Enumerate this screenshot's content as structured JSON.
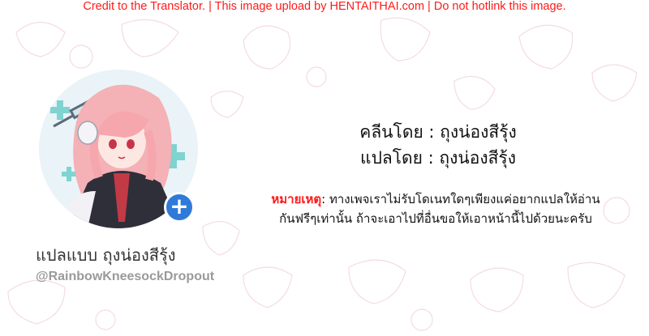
{
  "banner": {
    "text": "Credit to the Translator. | This image upload by HENTAITHAI.com | Do not hotlink this image.",
    "color": "#ff1a1a"
  },
  "profile": {
    "name": "แปลแบบ ถุงน่องสีรุ้ง",
    "handle": "@RainbowKneesockDropout",
    "badge_icon": "plus-icon",
    "badge_color": "#2f7ad8"
  },
  "credits": {
    "cleaned_by": "คลีนโดย : ถุงน่องสีรุ้ง",
    "translated_by": "แปลโดย : ถุงน่องสีรุ้ง"
  },
  "note": {
    "label": "หมายเหตุ",
    "line1_text": ": ทางเพจเราไม่รับโดเนทใดๆเพียงแค่อยากแปลให้อ่าน",
    "line2_text": "กันฟรีๆเท่านั้น ถ้าจะเอาไปที่อื่นขอให้เอาหน้านี้ไปด้วยนะครับ",
    "label_color": "#ff1a1a"
  }
}
